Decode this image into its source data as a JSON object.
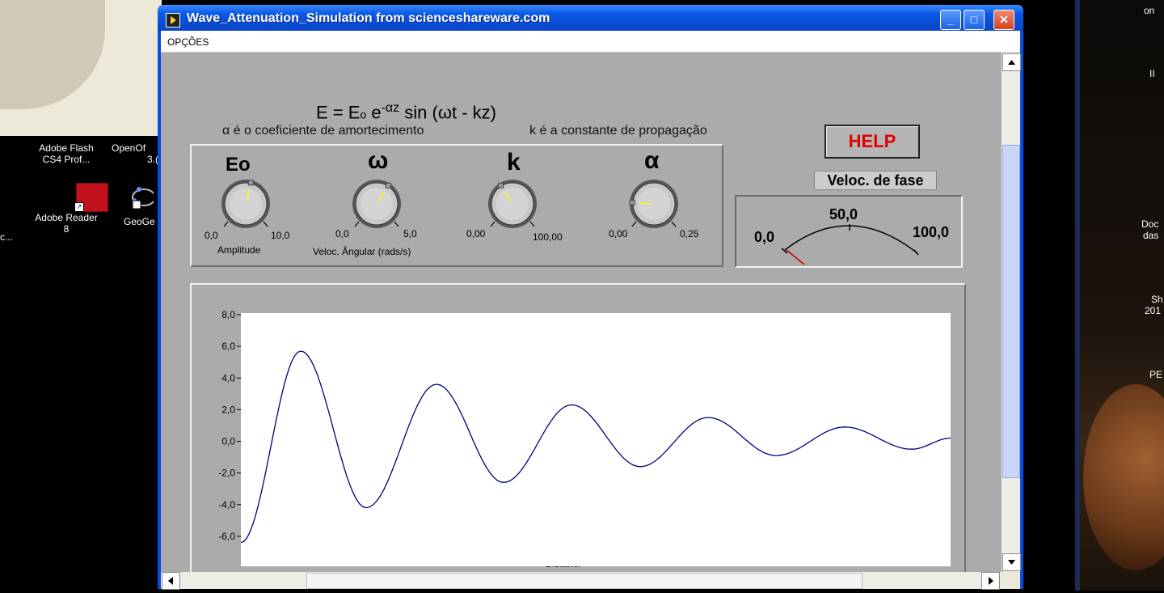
{
  "desktop": {
    "icons": [
      {
        "label_line1": "Adobe Flash",
        "label_line2": "CS4 Prof..."
      },
      {
        "label_line1": "OpenOf",
        "label_line2": "3.("
      },
      {
        "label_line1": "Adobe Reader",
        "label_line2": "8"
      },
      {
        "label_line1": "GeoGe",
        "label_line2": ""
      },
      {
        "label_line1": "c...",
        "label_line2": ""
      }
    ],
    "right_labels": [
      "on",
      "II",
      "Doc",
      "das",
      "Sh",
      "201",
      "PE"
    ]
  },
  "window": {
    "title": "Wave_Attenuation_Simulation from scienceshareware.com",
    "menu": [
      "OPÇÕES"
    ],
    "formula": {
      "lhs": "E = E",
      "sub": "o",
      "e": " e",
      "exp": "-αz",
      "rest": " sin (ωt - kz)"
    },
    "notes": {
      "alpha": "α é o coeficiente de amortecimento",
      "k": "k é a constante de propagação"
    },
    "help_label": "HELP",
    "knobs": [
      {
        "symbol": "Eo",
        "min": "0,0",
        "max": "10,0",
        "caption": "Amplitude",
        "value_fraction": 0.55
      },
      {
        "symbol": "ω",
        "min": "0,0",
        "max": "5,0",
        "caption": "Veloc. Ângular  (rads/s)",
        "value_fraction": 0.62
      },
      {
        "symbol": "k",
        "min": "0,00",
        "max": "100,00",
        "caption": "",
        "value_fraction": 0.38
      },
      {
        "symbol": "α",
        "min": "0,00",
        "max": "0,25",
        "caption": "",
        "value_fraction": 0.18
      }
    ],
    "phase_velocity": {
      "label": "Veloc. de fase",
      "min": "0,0",
      "mid": "50,0",
      "max": "100,0",
      "value_fraction": 0.02
    },
    "graph": {
      "xlabel": "Distânc."
    }
  },
  "chart_data": {
    "type": "line",
    "title": "",
    "xlabel": "Distânc.",
    "ylabel": "",
    "ylim": [
      -8,
      8
    ],
    "yticks": [
      "8,0",
      "6,0",
      "4,0",
      "2,0",
      "0,0",
      "-2,0",
      "-4,0",
      "-6,0",
      "-8,0"
    ],
    "series": [
      {
        "color": "#000080",
        "x": [
          0,
          0.09,
          0.28,
          0.48,
          0.67,
          0.86,
          1.05,
          1.24,
          1.43,
          1.62,
          1.81,
          2.0,
          2.19,
          2.38,
          2.57,
          2.76,
          2.95,
          3.14,
          3.33,
          3.52,
          3.71,
          3.9,
          4.09,
          4.28,
          4.47,
          4.6
        ],
        "y": [
          -6.5,
          5.6,
          -4.3,
          3.5,
          -2.7,
          2.2,
          -1.7,
          1.4,
          -1.0,
          0.8,
          -0.6,
          0.1,
          0,
          0,
          0,
          0,
          0,
          0,
          0,
          0,
          0,
          0,
          0,
          0,
          0,
          0
        ]
      }
    ]
  }
}
